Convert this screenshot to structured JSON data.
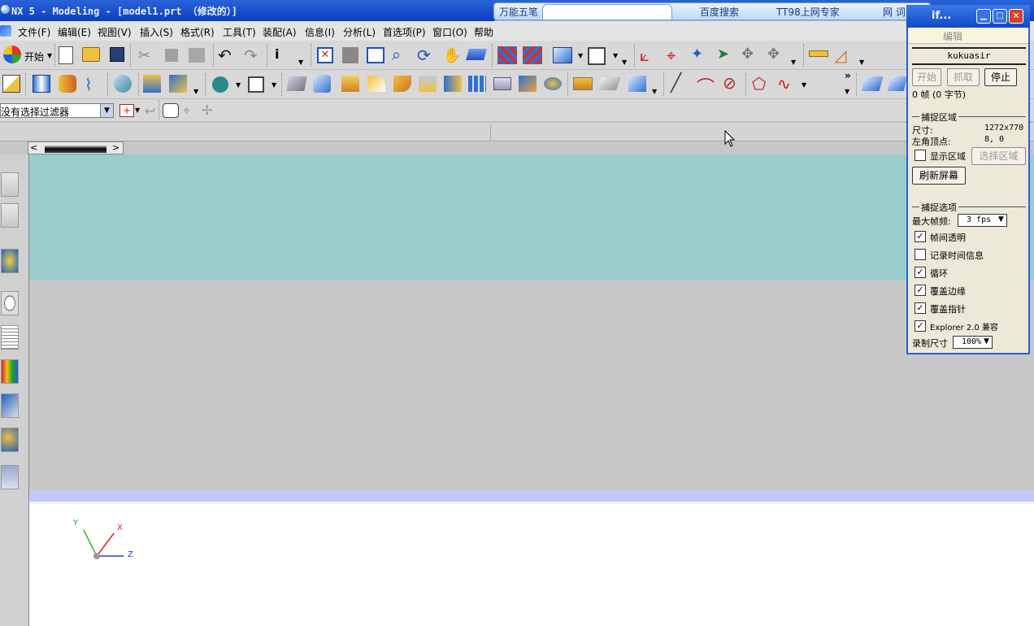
{
  "window": {
    "title": "NX 5 - Modeling - [model1.prt （修改的）]"
  },
  "menu": {
    "items": [
      "文件(F)",
      "编辑(E)",
      "视图(V)",
      "插入(S)",
      "格式(R)",
      "工具(T)",
      "装配(A)",
      "信息(I)",
      "分析(L)",
      "首选项(P)",
      "窗口(O)",
      "帮助"
    ]
  },
  "toolbar": {
    "start_label": "开始",
    "filter_value": "没有选择过滤器"
  },
  "ime_bar": {
    "tab1": "万能五笔",
    "tab2": "百度搜索",
    "tab3": "TT98上网专家",
    "tab4": "网 词"
  },
  "capture": {
    "title": "if...",
    "edit_tab": "编辑",
    "user": "kukuasir",
    "start_button": "开始",
    "grab_button": "抓取",
    "stop_button": "停止",
    "frames_text": "0 帧 (0 字节)",
    "region_section": "捕捉区域",
    "size_label": "尺寸:",
    "size_value": "1272x770",
    "topleft_label": "左角顶点:",
    "topleft_value": "8, 0",
    "show_region": "显示区域",
    "select_region": "选择区域",
    "refresh": "刷新屏幕",
    "options_section": "捕捉选项",
    "maxfps_label": "最大帧频:",
    "maxfps_value": "3 fps",
    "opt_transparent": "帧间透明",
    "opt_timeinfo": "记录时间信息",
    "opt_loop": "循环",
    "opt_edge": "覆盖边缘",
    "opt_pointer": "覆盖指针",
    "opt_explorer": "Explorer 2.0 兼容",
    "recsize_label": "录制尺寸",
    "recsize_value": "100%"
  },
  "viewport": {
    "axis_x": "X",
    "axis_y": "Y",
    "axis_z": "Z"
  },
  "colors": {
    "titlebar": "#0a3ec0",
    "teal": "#9acccc",
    "lavender": "#c8c8f8",
    "canvas": "#ffffff"
  }
}
